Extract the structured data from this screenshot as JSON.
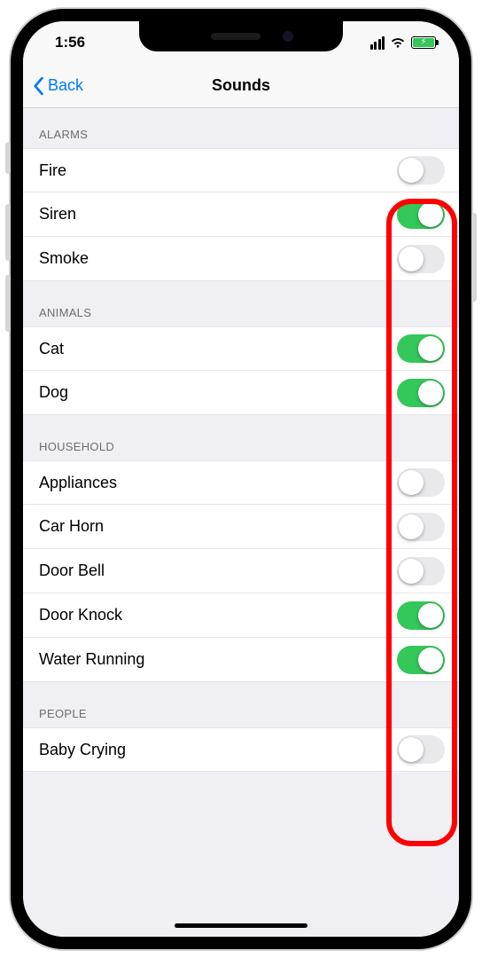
{
  "status": {
    "time": "1:56"
  },
  "nav": {
    "back": "Back",
    "title": "Sounds"
  },
  "sections": [
    {
      "title": "Alarms",
      "items": [
        {
          "label": "Fire",
          "on": false
        },
        {
          "label": "Siren",
          "on": true
        },
        {
          "label": "Smoke",
          "on": false
        }
      ]
    },
    {
      "title": "Animals",
      "items": [
        {
          "label": "Cat",
          "on": true
        },
        {
          "label": "Dog",
          "on": true
        }
      ]
    },
    {
      "title": "Household",
      "items": [
        {
          "label": "Appliances",
          "on": false
        },
        {
          "label": "Car Horn",
          "on": false
        },
        {
          "label": "Door Bell",
          "on": false
        },
        {
          "label": "Door Knock",
          "on": true
        },
        {
          "label": "Water Running",
          "on": true
        }
      ]
    },
    {
      "title": "People",
      "items": [
        {
          "label": "Baby Crying",
          "on": false
        }
      ]
    }
  ],
  "annotation": {
    "highlight_toggles": true
  }
}
